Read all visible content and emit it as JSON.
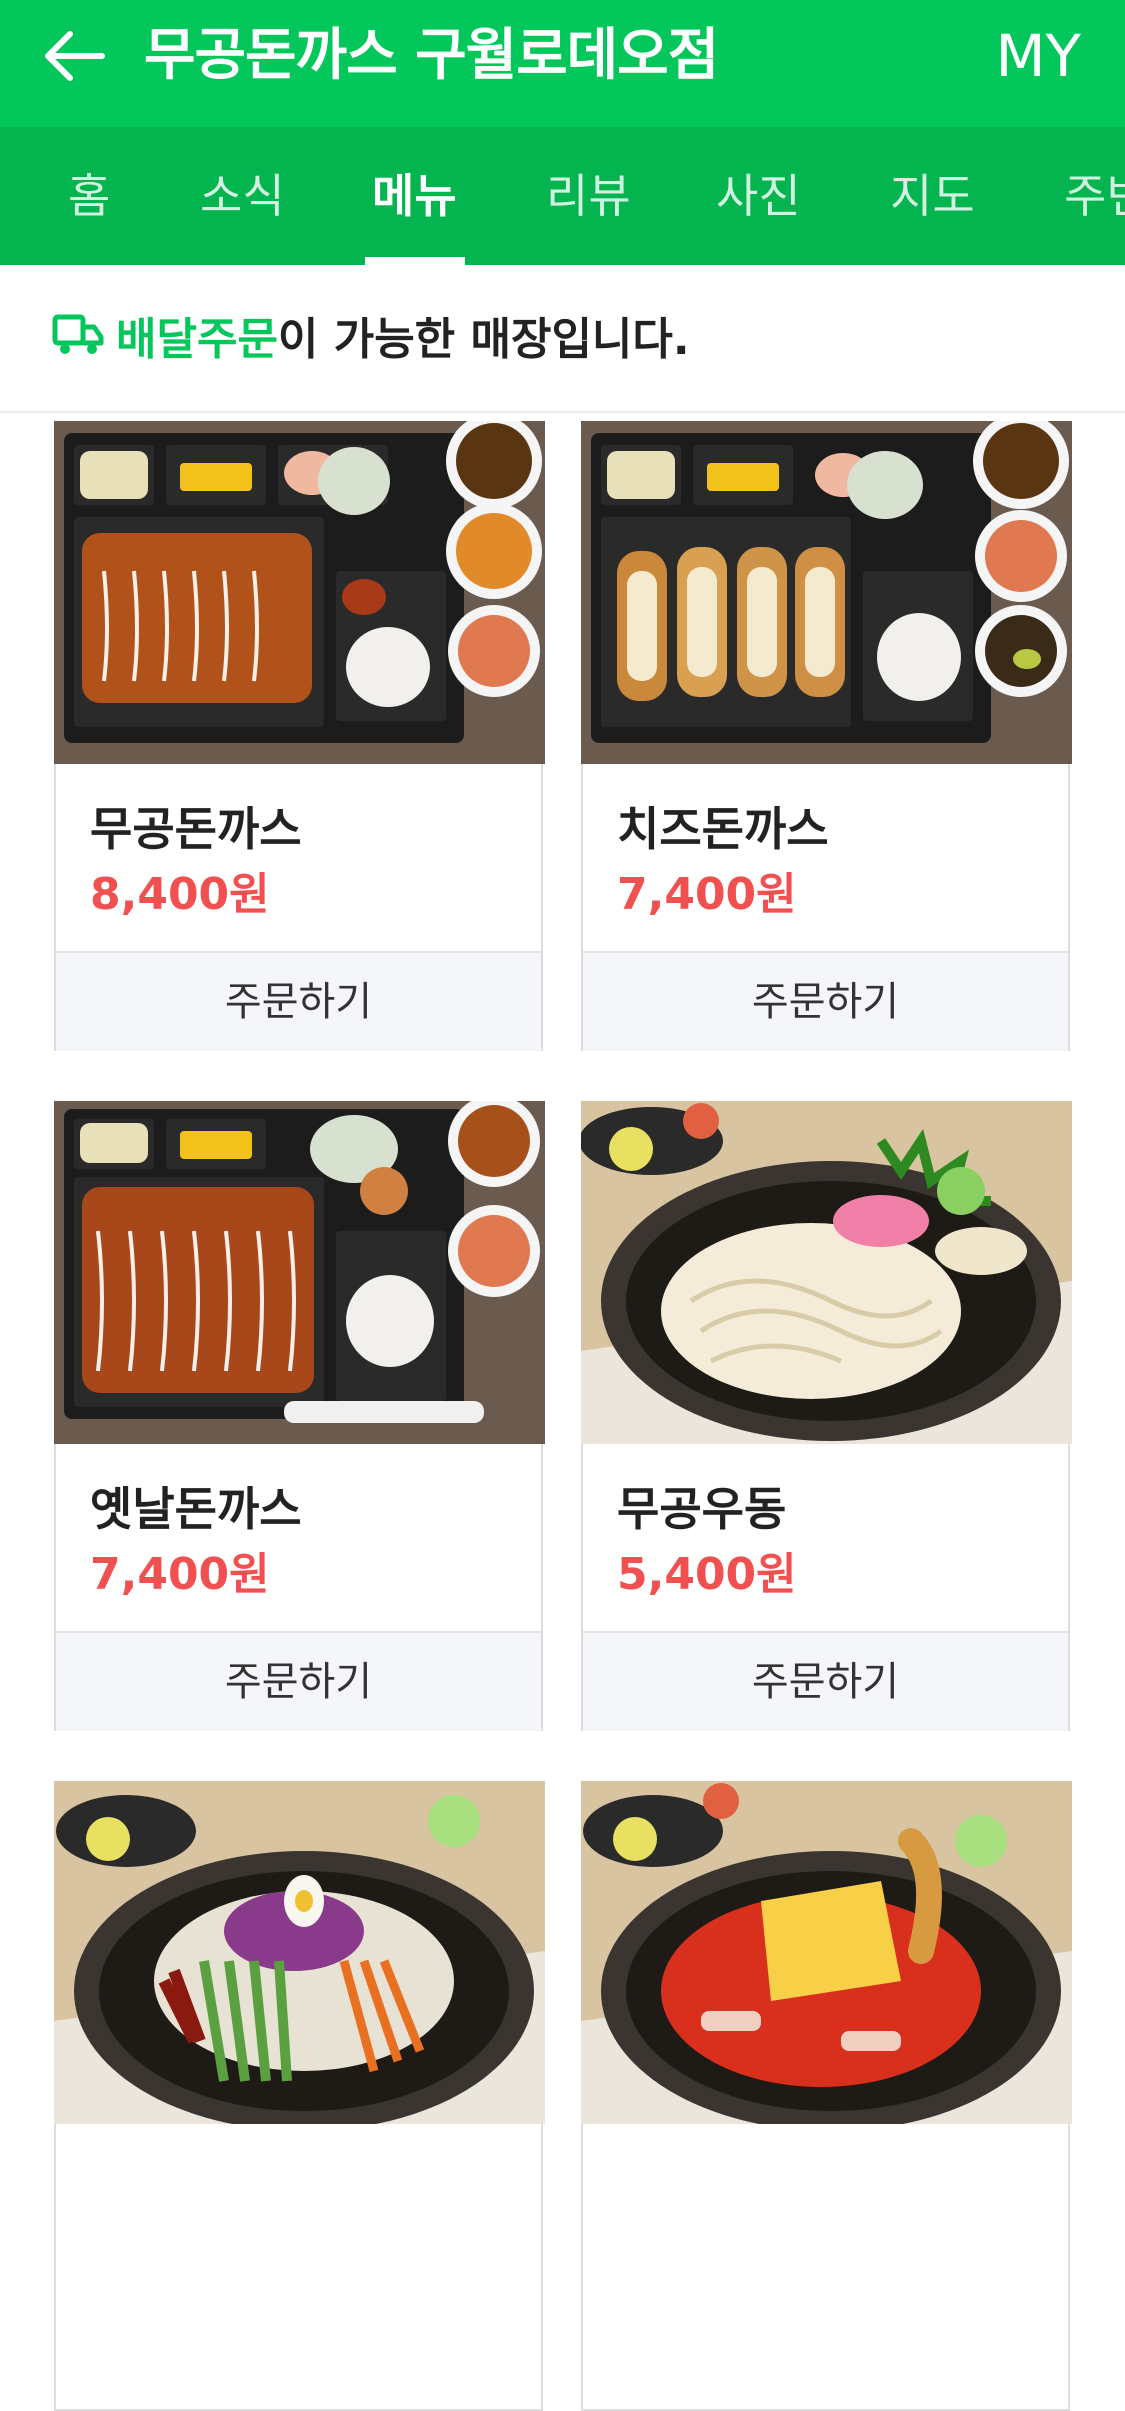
{
  "header": {
    "title": "무공돈까스 구월로데오점",
    "my_label": "MY",
    "bg_color": "#03c75a",
    "back_icon": "arrow-left-icon"
  },
  "tabs": [
    {
      "label": "홈",
      "active": false
    },
    {
      "label": "소식",
      "active": false
    },
    {
      "label": "메뉴",
      "active": true
    },
    {
      "label": "리뷰",
      "active": false
    },
    {
      "label": "사진",
      "active": false
    },
    {
      "label": "지도",
      "active": false
    },
    {
      "label": "주변",
      "active": false
    }
  ],
  "notice": {
    "icon": "delivery-truck-icon",
    "highlight": "배달주문",
    "rest": "이 가능한 매장입니다.",
    "highlight_color": "#03c75a"
  },
  "menu": {
    "order_label": "주문하기",
    "price_color": "#f05050",
    "items": [
      {
        "name": "무공돈까스",
        "price": "8,400원"
      },
      {
        "name": "치즈돈까스",
        "price": "7,400원"
      },
      {
        "name": "옛날돈까스",
        "price": "7,400원"
      },
      {
        "name": "무공우동",
        "price": "5,400원"
      },
      {
        "name": "",
        "price": ""
      },
      {
        "name": "",
        "price": ""
      }
    ]
  }
}
